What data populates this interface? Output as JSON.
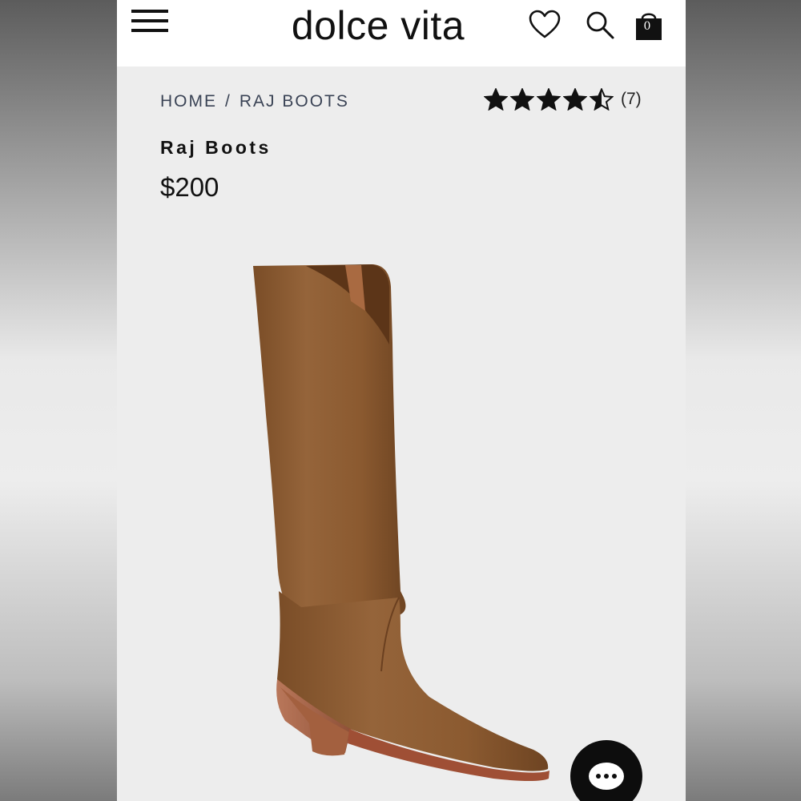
{
  "header": {
    "brand": "dolce vita",
    "cart_count": "0",
    "icons": [
      "menu-icon",
      "heart-icon",
      "search-icon",
      "shopping-bag-icon"
    ]
  },
  "breadcrumb": {
    "home": "HOME",
    "separator": "/",
    "current": "RAJ BOOTS"
  },
  "rating": {
    "stars": 4.5,
    "max": 5,
    "review_count": "(7)"
  },
  "product": {
    "name": "Raj Boots",
    "price": "$200",
    "image_subject": "tall brown suede western boot"
  },
  "chat": {
    "icon": "chat-icon"
  },
  "colors": {
    "page_background": "#ededed",
    "header_background": "#ffffff",
    "breadcrumb_text": "#3a4355",
    "boot_suede": "#8b5a2e",
    "chat_button": "#0d0d0d"
  }
}
